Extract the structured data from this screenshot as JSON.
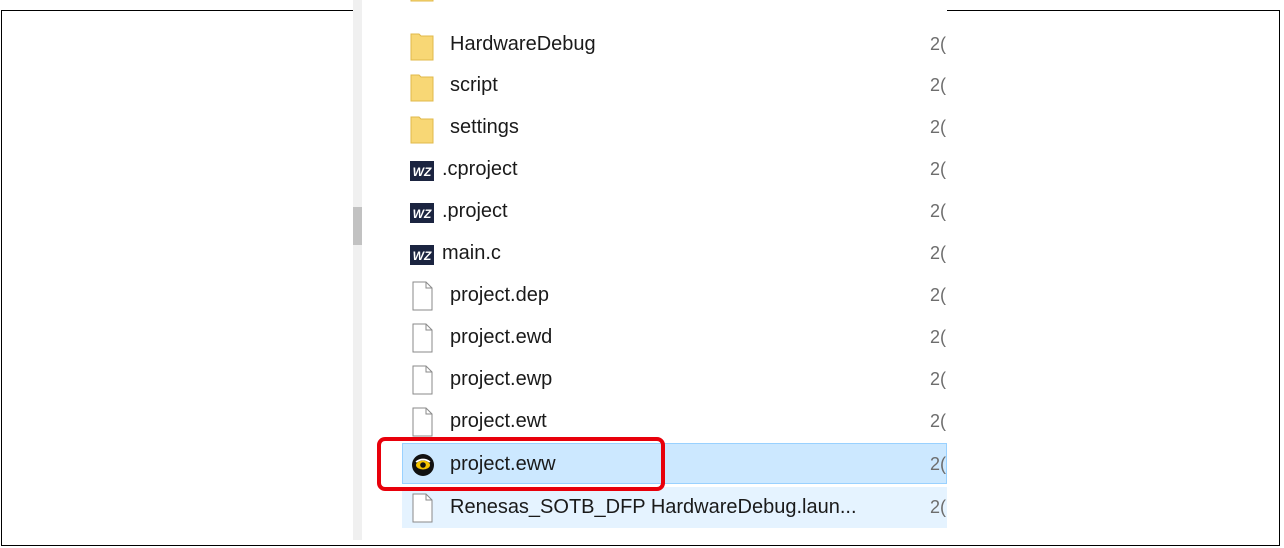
{
  "explorer": {
    "items": [
      {
        "name": "",
        "type": "folder",
        "date": "2("
      },
      {
        "name": "HardwareDebug",
        "type": "folder",
        "date": "2("
      },
      {
        "name": "script",
        "type": "folder",
        "date": "2("
      },
      {
        "name": "settings",
        "type": "folder",
        "date": "2("
      },
      {
        "name": ".cproject",
        "type": "wz-file",
        "date": "2("
      },
      {
        "name": ".project",
        "type": "wz-file",
        "date": "2("
      },
      {
        "name": "main.c",
        "type": "wz-file",
        "date": "2("
      },
      {
        "name": "project.dep",
        "type": "file",
        "date": "2("
      },
      {
        "name": "project.ewd",
        "type": "file",
        "date": "2("
      },
      {
        "name": "project.ewp",
        "type": "file",
        "date": "2("
      },
      {
        "name": "project.ewt",
        "type": "file",
        "date": "2("
      },
      {
        "name": "project.eww",
        "type": "workspace",
        "date": "2(",
        "selected": true
      },
      {
        "name": "Renesas_SOTB_DFP HardwareDebug.laun...",
        "type": "file",
        "date": "2(",
        "hover": true
      }
    ],
    "icon_labels": {
      "wz": "WZ"
    }
  },
  "colors": {
    "highlight": "#e8000b",
    "selection": "#cce8ff",
    "folder": "#f8d775"
  }
}
